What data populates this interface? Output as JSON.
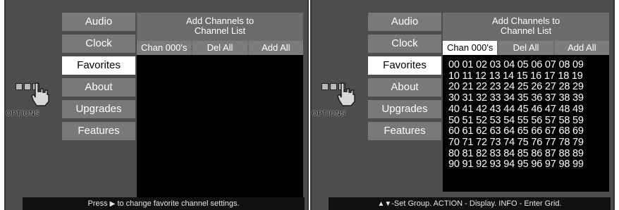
{
  "colors": {
    "screen_bg": "#4d4d4d",
    "menu_item": "#797979",
    "menu_selected": "#ffffff",
    "panel_header": "#6c6c6c",
    "grid_bg": "#000000",
    "status_bg": "#111111"
  },
  "left": {
    "logo_text": "OPTIONS",
    "menu": [
      "Audio",
      "Clock",
      "Favorites",
      "About",
      "Upgrades",
      "Features"
    ],
    "selected_menu": "Favorites",
    "panel": {
      "title_line1": "Add Channels to",
      "title_line2": "Channel List",
      "tabs": [
        "Chan 000's",
        "Del All",
        "Add All"
      ],
      "active_tab": null
    },
    "status": {
      "prefix": "Press",
      "arrow": "▶",
      "suffix": "to change favorite channel settings."
    }
  },
  "right": {
    "logo_text": "OPTIONS",
    "menu": [
      "Audio",
      "Clock",
      "Favorites",
      "About",
      "Upgrades",
      "Features"
    ],
    "selected_menu": "Favorites",
    "panel": {
      "title_line1": "Add Channels to",
      "title_line2": "Channel List",
      "tabs": [
        "Chan 000's",
        "Del All",
        "Add All"
      ],
      "active_tab": "Chan 000's",
      "grid_rows": [
        "00 01 02 03 04 05 06 07 08 09",
        "10 11 12 13 14 15 16 17 18 19",
        "20 21 22 23 24 25 26 27 28 29",
        "30 31 32 33 34 35 36 37 38 39",
        "40 41 42 43 44 45 46 47 48 49",
        "50 51 52 53 54 55 56 57 58 59",
        "60 61 62 63 64 65 66 67 68 69",
        "70 71 72 73 74 75 76 77 78 79",
        "80 81 82 83 84 85 86 87 88 89",
        "90 91 92 93 94 95 96 97 98 99"
      ]
    },
    "status": {
      "arrows": "▲▼",
      "text": "-Set Group. ACTION - Display. INFO - Enter Grid."
    }
  }
}
